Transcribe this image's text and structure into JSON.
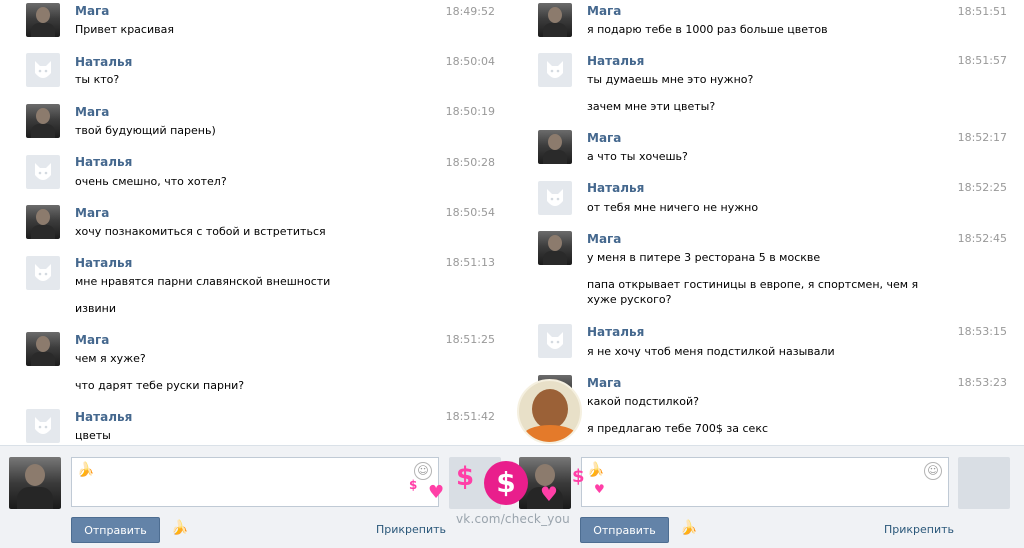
{
  "left_messages": [
    {
      "author": "Мага",
      "time": "18:49:52",
      "lines": [
        "Привет красивая"
      ]
    },
    {
      "author": "Наталья",
      "time": "18:50:04",
      "lines": [
        "ты кто?"
      ]
    },
    {
      "author": "Мага",
      "time": "18:50:19",
      "lines": [
        "твой будующий парень)"
      ]
    },
    {
      "author": "Наталья",
      "time": "18:50:28",
      "lines": [
        "очень смешно, что хотел?"
      ]
    },
    {
      "author": "Мага",
      "time": "18:50:54",
      "lines": [
        "хочу познакомиться с тобой и встретиться"
      ]
    },
    {
      "author": "Наталья",
      "time": "18:51:13",
      "lines": [
        "мне нравятся парни славянской внешности",
        "извини"
      ]
    },
    {
      "author": "Мага",
      "time": "18:51:25",
      "lines": [
        "чем я хуже?",
        "что дарят тебе руски парни?"
      ]
    },
    {
      "author": "Наталья",
      "time": "18:51:42",
      "lines": [
        "цветы"
      ]
    }
  ],
  "right_messages": [
    {
      "author": "Мага",
      "time": "18:51:51",
      "lines": [
        "я подарю тебе в 1000 раз больше цветов"
      ]
    },
    {
      "author": "Наталья",
      "time": "18:51:57",
      "lines": [
        "ты думаешь мне это нужно?",
        "зачем мне эти цветы?"
      ]
    },
    {
      "author": "Мага",
      "time": "18:52:17",
      "lines": [
        "а что ты хочешь?"
      ]
    },
    {
      "author": "Наталья",
      "time": "18:52:25",
      "lines": [
        "от тебя мне ничего не нужно"
      ]
    },
    {
      "author": "Мага",
      "time": "18:52:45",
      "lines": [
        "у меня в питере 3 ресторана 5 в москве",
        "папа открывает гостиницы в европе, я спортсмен, чем я хуже рускогo?"
      ]
    },
    {
      "author": "Наталья",
      "time": "18:53:15",
      "lines": [
        "я не хочу чтоб меня подстилкой называли"
      ]
    },
    {
      "author": "Мага",
      "time": "18:53:23",
      "lines": [
        "какой подстилкой?",
        "я предлагаю тебе 700$ за секс"
      ]
    }
  ],
  "composer": {
    "send_label": "Отправить",
    "attach_label": "Прикрепить"
  },
  "watermark": "vk.com/check_you",
  "overlay_dollar": "$",
  "icons": {
    "banana": "banana-icon",
    "smiley": "smiley-icon",
    "dog": "vk-dog-avatar-icon"
  },
  "colors": {
    "name": "#45688e",
    "send": "#6383a8",
    "link": "#2b587a",
    "time": "#999999",
    "deco": "#ff3fa7"
  }
}
